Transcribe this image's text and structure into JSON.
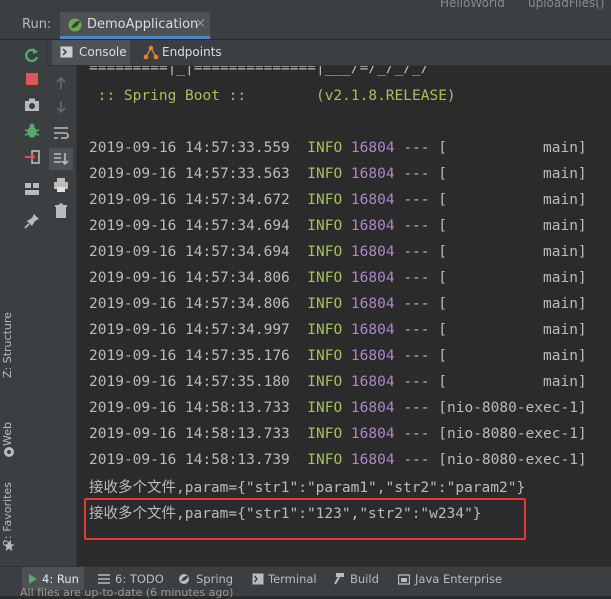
{
  "window": {
    "top_left_text": "",
    "top_right_tabs": [
      "HelloWorld",
      "uploadFiles()"
    ]
  },
  "run": {
    "label": "Run:",
    "tab_name": "DemoApplication",
    "tab_close": "×"
  },
  "subtabs": [
    {
      "label": "Console",
      "active": true
    },
    {
      "label": "Endpoints",
      "active": false
    }
  ],
  "side_tabs": [
    "Z: Structure",
    "Web",
    "2: Favorites"
  ],
  "console": {
    "banner_art": "=========|_|==============|___/=/_/_/_/",
    "banner_line": " :: Spring Boot ::        (v2.1.8.RELEASE)",
    "logs": [
      {
        "ts": "2019-09-16 14:57:33.559",
        "level": "INFO",
        "pid": "16804",
        "sep": "---",
        "thread": "[           main]"
      },
      {
        "ts": "2019-09-16 14:57:33.563",
        "level": "INFO",
        "pid": "16804",
        "sep": "---",
        "thread": "[           main]"
      },
      {
        "ts": "2019-09-16 14:57:34.672",
        "level": "INFO",
        "pid": "16804",
        "sep": "---",
        "thread": "[           main]"
      },
      {
        "ts": "2019-09-16 14:57:34.694",
        "level": "INFO",
        "pid": "16804",
        "sep": "---",
        "thread": "[           main]"
      },
      {
        "ts": "2019-09-16 14:57:34.694",
        "level": "INFO",
        "pid": "16804",
        "sep": "---",
        "thread": "[           main]"
      },
      {
        "ts": "2019-09-16 14:57:34.806",
        "level": "INFO",
        "pid": "16804",
        "sep": "---",
        "thread": "[           main]"
      },
      {
        "ts": "2019-09-16 14:57:34.806",
        "level": "INFO",
        "pid": "16804",
        "sep": "---",
        "thread": "[           main]"
      },
      {
        "ts": "2019-09-16 14:57:34.997",
        "level": "INFO",
        "pid": "16804",
        "sep": "---",
        "thread": "[           main]"
      },
      {
        "ts": "2019-09-16 14:57:35.176",
        "level": "INFO",
        "pid": "16804",
        "sep": "---",
        "thread": "[           main]"
      },
      {
        "ts": "2019-09-16 14:57:35.180",
        "level": "INFO",
        "pid": "16804",
        "sep": "---",
        "thread": "[           main]"
      },
      {
        "ts": "2019-09-16 14:58:13.733",
        "level": "INFO",
        "pid": "16804",
        "sep": "---",
        "thread": "[nio-8080-exec-1]"
      },
      {
        "ts": "2019-09-16 14:58:13.733",
        "level": "INFO",
        "pid": "16804",
        "sep": "---",
        "thread": "[nio-8080-exec-1]"
      },
      {
        "ts": "2019-09-16 14:58:13.739",
        "level": "INFO",
        "pid": "16804",
        "sep": "---",
        "thread": "[nio-8080-exec-1]"
      }
    ],
    "output_lines": [
      "接收多个文件,param={\"str1\":\"param1\",\"str2\":\"param2\"}",
      "接收多个文件,param={\"str1\":\"123\",\"str2\":\"w234\"}"
    ],
    "highlight_color": "#e53935"
  },
  "bottom_tabs": [
    {
      "label": "4: Run",
      "active": true
    },
    {
      "label": "6: TODO",
      "active": false
    },
    {
      "label": "Spring",
      "active": false
    },
    {
      "label": "Terminal",
      "active": false
    },
    {
      "label": "Build",
      "active": false
    },
    {
      "label": "Java Enterprise",
      "active": false
    }
  ],
  "status": {
    "text": "All files are up-to-date (6 minutes ago)"
  },
  "colors": {
    "info": "#a5c25c",
    "pid": "#b086c9",
    "accent": "#4a88c7",
    "run_icon": "#59a869",
    "stop_icon": "#e05555"
  }
}
